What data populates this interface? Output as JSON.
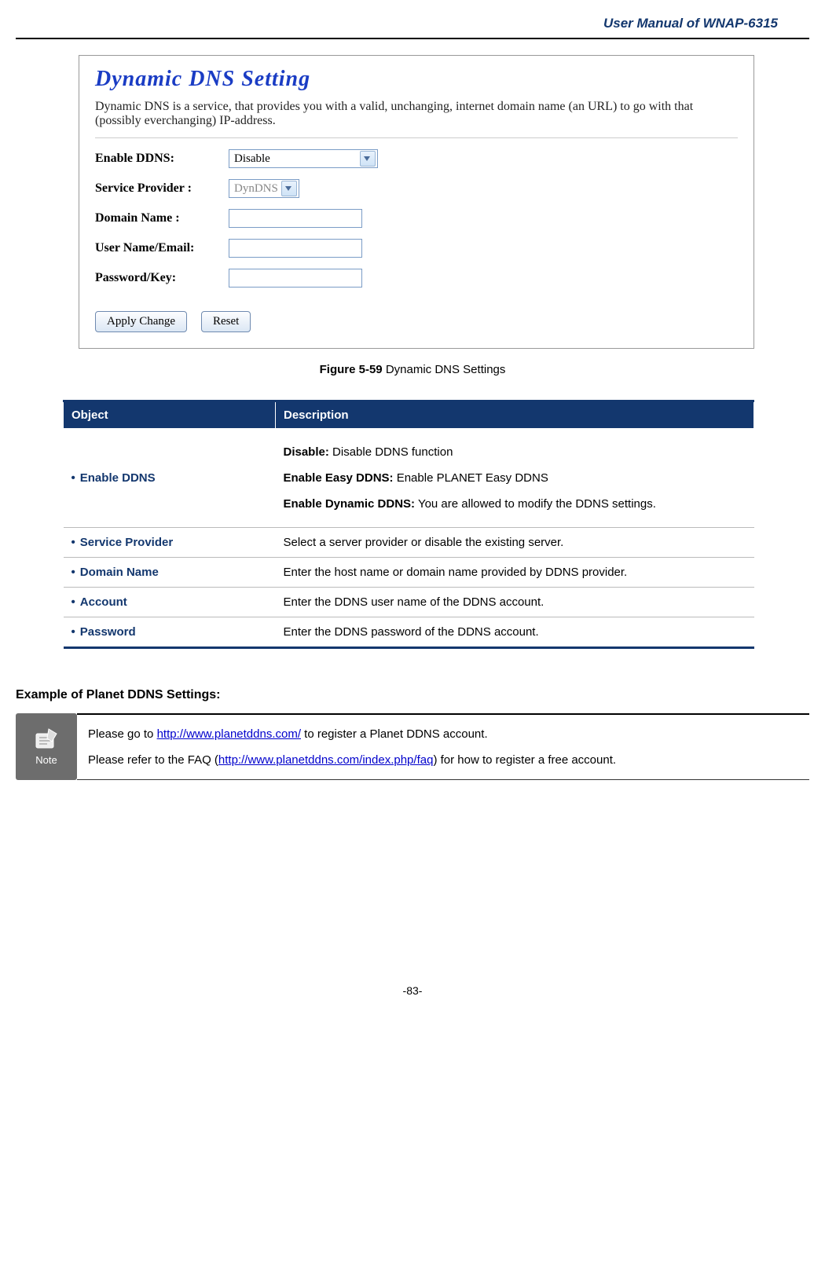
{
  "header": {
    "title": "User Manual of WNAP-6315"
  },
  "figure": {
    "title": "Dynamic DNS  Setting",
    "description": "Dynamic DNS is a service, that provides you with a valid, unchanging, internet domain name (an URL) to go with that (possibly everchanging) IP-address.",
    "labels": {
      "enable": "Enable DDNS:",
      "provider": "Service Provider :",
      "domain": "Domain Name :",
      "user": "User Name/Email:",
      "password": "Password/Key:"
    },
    "values": {
      "enable": "Disable",
      "provider": "DynDNS"
    },
    "buttons": {
      "apply": "Apply Change",
      "reset": "Reset"
    }
  },
  "caption": {
    "bold": "Figure 5-59",
    "text": " Dynamic DNS Settings"
  },
  "table": {
    "headers": {
      "object": "Object",
      "description": "Description"
    },
    "rows": [
      {
        "object": "Enable DDNS",
        "desc": [
          {
            "b": "Disable:",
            "t": " Disable DDNS function"
          },
          {
            "b": "Enable Easy DDNS:",
            "t": " Enable PLANET Easy DDNS"
          },
          {
            "b": "Enable Dynamic DDNS:",
            "t": " You are allowed to modify the DDNS settings."
          }
        ]
      },
      {
        "object": "Service Provider",
        "desc_plain": "Select a server provider or disable the existing server."
      },
      {
        "object": "Domain Name",
        "desc_plain": "Enter the host name or domain name provided by DDNS provider."
      },
      {
        "object": "Account",
        "desc_plain": "Enter the DDNS user name of the DDNS account."
      },
      {
        "object": "Password",
        "desc_plain": "Enter the DDNS password of the DDNS account."
      }
    ]
  },
  "example_heading": "Example of Planet DDNS Settings:",
  "note": {
    "label": "Note",
    "line1_pre": "Please go to ",
    "line1_link": "http://www.planetddns.com/",
    "line1_post": " to register a Planet DDNS account.",
    "line2_pre": "Please refer to the FAQ (",
    "line2_link": "http://www.planetddns.com/index.php/faq",
    "line2_post": ") for how to register a free account."
  },
  "footer": "-83-"
}
